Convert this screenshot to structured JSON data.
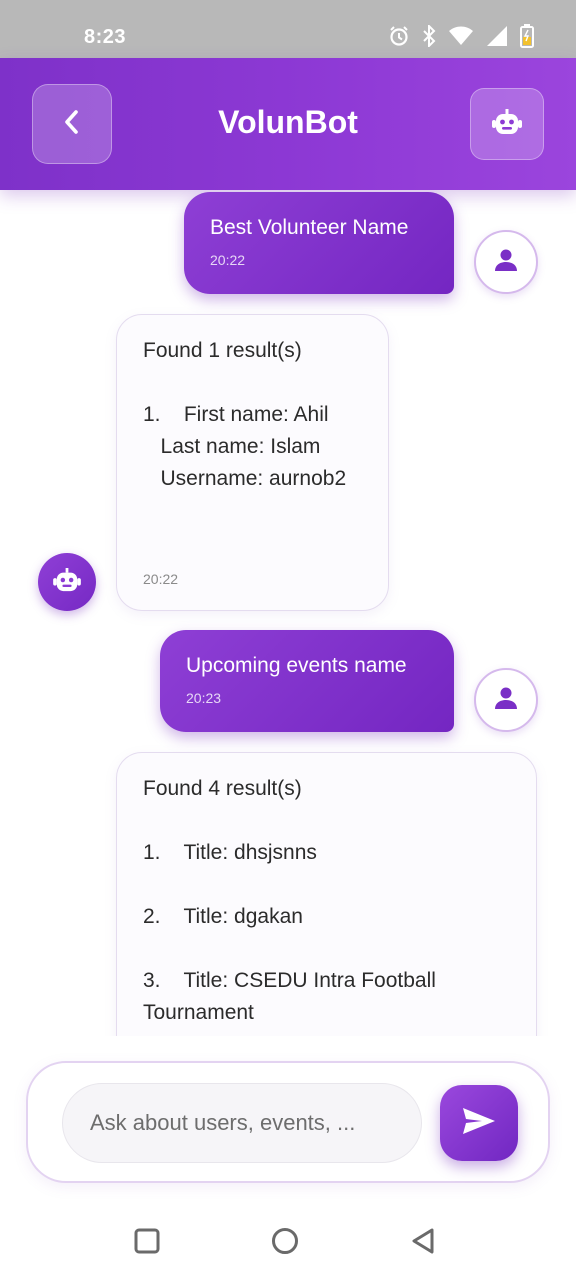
{
  "status_bar": {
    "time": "8:23",
    "icons": [
      "alarm-icon",
      "bluetooth-icon",
      "wifi-icon",
      "signal-icon",
      "battery-icon"
    ]
  },
  "header": {
    "title": "VolunBot",
    "back_icon": "chevron-left-icon",
    "bot_icon": "robot-icon"
  },
  "messages": [
    {
      "sender": "user",
      "text": "Best Volunteer Name",
      "time": "20:22"
    },
    {
      "sender": "bot",
      "text": "Found 1 result(s)\n\n1.    First name: Ahil\n   Last name: Islam\n   Username: aurnob2",
      "time": "20:22"
    },
    {
      "sender": "user",
      "text": "Upcoming events name",
      "time": "20:23"
    },
    {
      "sender": "bot",
      "text": "Found 4 result(s)\n\n1.    Title: dhsjsnns\n\n2.    Title: dgakan\n\n3.    Title: CSEDU Intra Football\nTournament"
    }
  ],
  "input": {
    "placeholder": "Ask about users, events, ..."
  },
  "nav": [
    "recents-square-icon",
    "home-circle-icon",
    "back-triangle-icon"
  ],
  "colors": {
    "primary": "#7e31c9",
    "primary_light": "#9b45dd",
    "bot_bubble_bg": "#fcfbfe",
    "status_bar": "#b8b8b8"
  }
}
